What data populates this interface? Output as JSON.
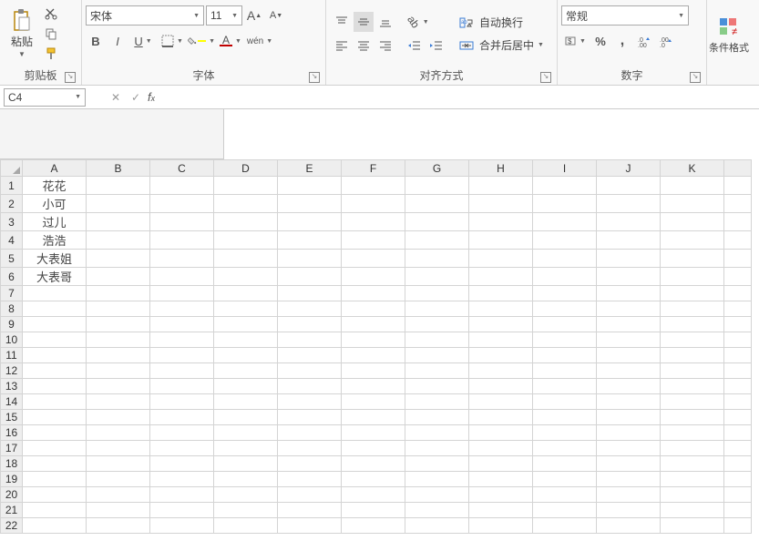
{
  "ribbon": {
    "clipboard": {
      "paste": "粘贴",
      "title": "剪贴板"
    },
    "font": {
      "name": "宋体",
      "size": "11",
      "bold": "B",
      "italic": "I",
      "underline": "U",
      "phonetic": "wén",
      "title": "字体"
    },
    "alignment": {
      "wrap": "自动换行",
      "merge": "合并后居中",
      "title": "对齐方式"
    },
    "number": {
      "format": "常规",
      "percent": "%",
      "comma": ",",
      "title": "数字"
    },
    "styles": {
      "cond": "条件格式"
    }
  },
  "namebox": "C4",
  "formula": "",
  "columns": [
    "A",
    "B",
    "C",
    "D",
    "E",
    "F",
    "G",
    "H",
    "I",
    "J",
    "K"
  ],
  "rows": [
    "1",
    "2",
    "3",
    "4",
    "5",
    "6",
    "7",
    "8",
    "9",
    "10",
    "11",
    "12",
    "13",
    "14",
    "15",
    "16",
    "17",
    "18",
    "19",
    "20",
    "21",
    "22"
  ],
  "cells": {
    "A1": "花花",
    "A2": "小可",
    "A3": "过儿",
    "A4": "浩浩",
    "A5": "大表姐",
    "A6": "大表哥"
  }
}
